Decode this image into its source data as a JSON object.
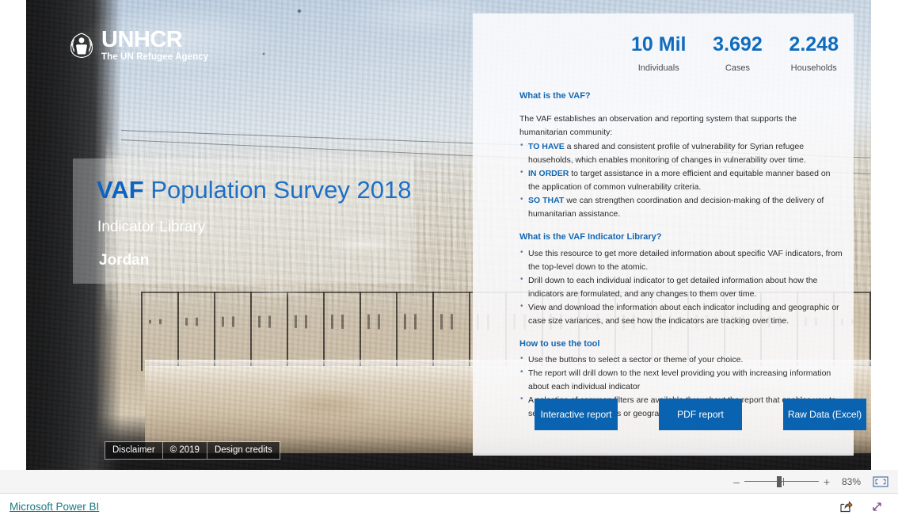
{
  "report": {
    "logo": {
      "emblem": "unhcr-laurel-emblem",
      "brand": "UNHCR",
      "tagline": "The UN Refugee Agency"
    },
    "title": {
      "highlight": "VAF",
      "rest": " Population Survey 2018",
      "subtitle": "Indicator Library",
      "country": "Jordan"
    },
    "photo_footer": [
      {
        "label": "Disclaimer"
      },
      {
        "label": "© 2019"
      },
      {
        "label": "Design credits"
      }
    ],
    "kpis": [
      {
        "value": "10 Mil",
        "label": "Individuals"
      },
      {
        "value": "3.692",
        "label": "Cases"
      },
      {
        "value": "2.248",
        "label": "Households"
      }
    ],
    "sections": [
      {
        "heading": "What is the VAF?",
        "intro": "The VAF establishes an observation and reporting system that supports the humanitarian community:",
        "bullets": [
          {
            "lead": "TO HAVE",
            "text": " a shared and consistent profile of vulnerability for Syrian refugee households, which enables monitoring of changes in vulnerability over time."
          },
          {
            "lead": "IN ORDER",
            "text": " to target assistance in a more efficient and equitable manner based on the application of common vulnerability criteria."
          },
          {
            "lead": "SO THAT",
            "text": " we can strengthen coordination and decision-making of the delivery of humanitarian assistance."
          }
        ]
      },
      {
        "heading": "What is the VAF Indicator Library?",
        "intro": "",
        "bullets": [
          {
            "lead": "",
            "text": "Use this resource to get more detailed information about specific VAF indicators, from the top-level down to the atomic."
          },
          {
            "lead": "",
            "text": "Drill down to each individual indicator to get detailed information about how the indicators are formulated, and any changes to them over time."
          },
          {
            "lead": "",
            "text": "View and download the information about each indicator including and geographic or case size variances, and see how the indicators are tracking over time."
          }
        ]
      },
      {
        "heading": "How to use the tool",
        "intro": "",
        "bullets": [
          {
            "lead": "",
            "text": "Use the buttons to select a sector or theme of your choice."
          },
          {
            "lead": "",
            "text": "The report will drill down to the next level providing you with increasing information about each individual indicator"
          },
          {
            "lead": "",
            "text": "A selection of common filters are available throughout the report that enables you to select specific case sizes or geographic regions."
          }
        ]
      }
    ],
    "actions": [
      {
        "label": "Interactive report"
      },
      {
        "label": "PDF report"
      },
      {
        "label": "Raw Data (Excel)"
      }
    ]
  },
  "viewer": {
    "zoom": {
      "minus": "–",
      "plus": "+",
      "percent": "83%",
      "fit_icon": "fit-to-page-icon"
    },
    "footer": {
      "brand_link": "Microsoft Power BI",
      "share_icon": "share-icon",
      "fullscreen_icon": "fullscreen-icon"
    }
  },
  "colors": {
    "accent_blue": "#0f6cbd",
    "button_blue": "#0a63b0",
    "heading_blue": "#1267b3",
    "link_teal": "#1a7a82"
  }
}
